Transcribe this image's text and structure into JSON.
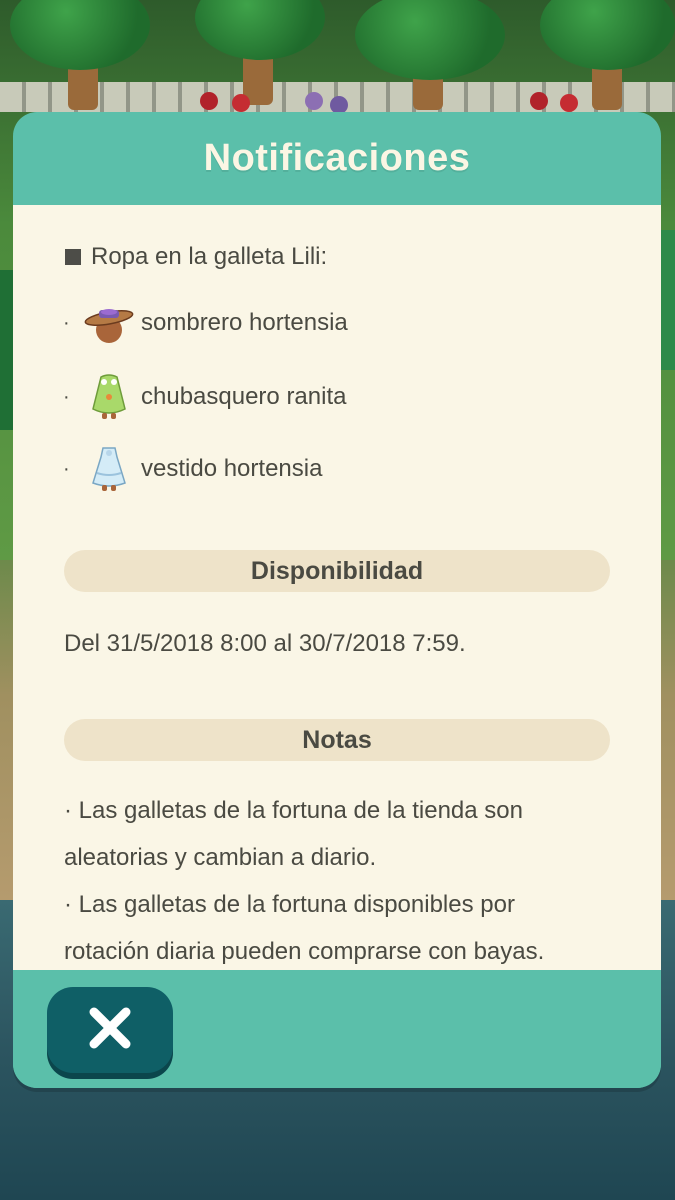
{
  "dialog": {
    "title": "Notificaciones",
    "intro": "Ropa en la galleta Lili:",
    "items": [
      {
        "bullet": "·",
        "label": "sombrero hortensia",
        "icon": "hat-icon"
      },
      {
        "bullet": "·",
        "label": "chubasquero ranita",
        "icon": "raincoat-icon"
      },
      {
        "bullet": "·",
        "label": "vestido hortensia",
        "icon": "dress-icon"
      }
    ],
    "availability": {
      "heading": "Disponibilidad",
      "text": "Del 31/5/2018 8:00 al 30/7/2018 7:59."
    },
    "notes": {
      "heading": "Notas",
      "lines": [
        "· Las galletas de la fortuna de la tienda son",
        "aleatorias y cambian a diario.",
        "· Las galletas de la fortuna disponibles por",
        "rotación diaria pueden comprarse con bayas."
      ]
    },
    "close_icon": "close-icon"
  },
  "colors": {
    "panel_teal": "#5bbfaa",
    "content_bg": "#faf6e6",
    "section_bar": "#eee3c9",
    "text": "#4a4a42",
    "close_button": "#0f5f66"
  }
}
